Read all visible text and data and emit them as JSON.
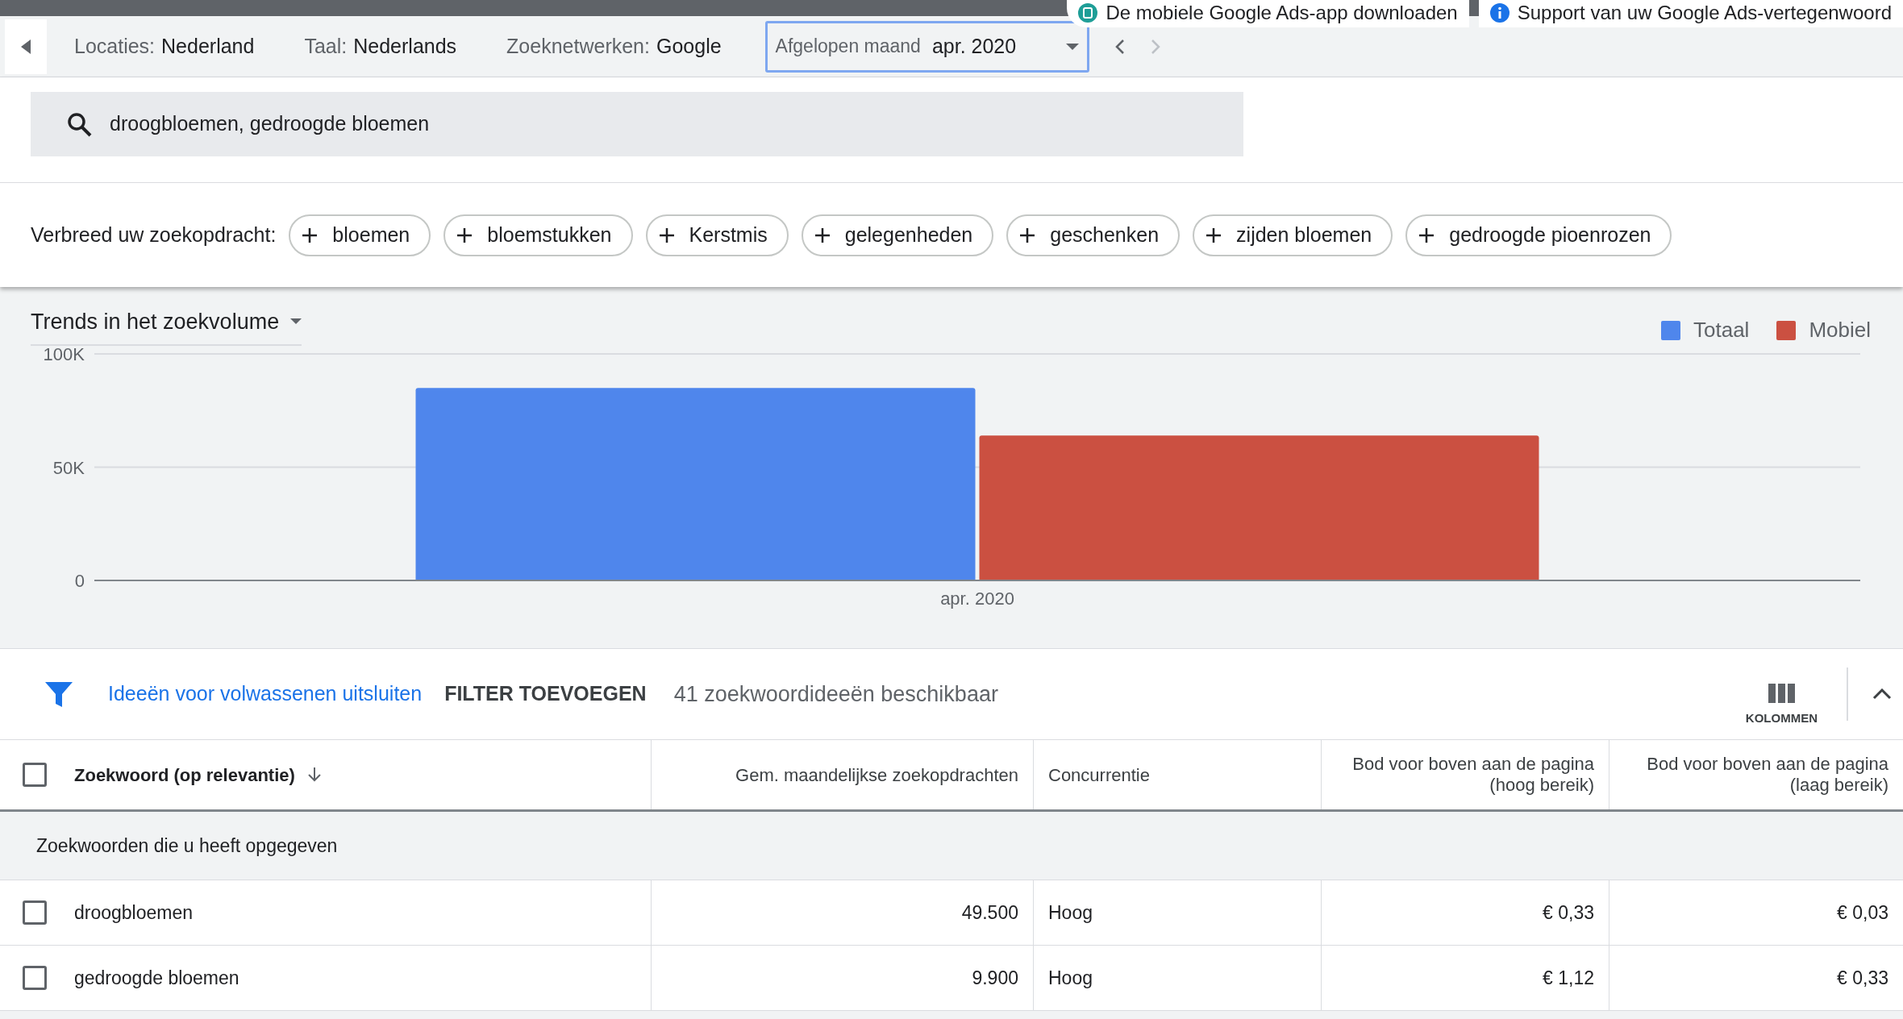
{
  "notifications": [
    {
      "kind": "app",
      "text": "De mobiele Google Ads-app downloaden"
    },
    {
      "kind": "info",
      "text": "Support van uw Google Ads-vertegenwoord"
    }
  ],
  "top_bar": {
    "filters": [
      {
        "label": "Locaties:",
        "value": "Nederland"
      },
      {
        "label": "Taal:",
        "value": "Nederlands"
      },
      {
        "label": "Zoeknetwerken:",
        "value": "Google"
      }
    ],
    "date_range": {
      "label": "Afgelopen maand",
      "value": "apr. 2020"
    }
  },
  "search": {
    "value": "droogbloemen, gedroogde bloemen"
  },
  "refine": {
    "label": "Verbreed uw zoekopdracht:",
    "chips": [
      "bloemen",
      "bloemstukken",
      "Kerstmis",
      "gelegenheden",
      "geschenken",
      "zijden bloemen",
      "gedroogde pioenrozen"
    ]
  },
  "trends": {
    "title": "Trends in het zoekvolume",
    "chart_data": {
      "type": "bar",
      "categories": [
        "apr. 2020"
      ],
      "series": [
        {
          "name": "Totaal",
          "color": "#4f86ec",
          "values": [
            85000
          ]
        },
        {
          "name": "Mobiel",
          "color": "#cb5041",
          "values": [
            64000
          ]
        }
      ],
      "ylim": [
        0,
        100000
      ],
      "yticks": [
        {
          "value": 0,
          "label": "0"
        },
        {
          "value": 50000,
          "label": "50K"
        },
        {
          "value": 100000,
          "label": "100K"
        }
      ]
    }
  },
  "filter_bar": {
    "exclude_link": "Ideeën voor volwassenen uitsluiten",
    "add_filter": "FILTER TOEVOEGEN",
    "count": "41 zoekwoordideeën beschikbaar",
    "columns_button": "KOLOMMEN"
  },
  "table": {
    "select_all_checked": false,
    "columns": [
      "Zoekwoord (op relevantie)",
      "Gem. maandelijkse zoekopdrachten",
      "Concurrentie",
      "Bod voor boven aan de pagina (hoog bereik)",
      "Bod voor boven aan de pagina (laag bereik)"
    ],
    "sections": [
      {
        "title": "Zoekwoorden die u heeft opgegeven",
        "rows": [
          {
            "checked": false,
            "cells": [
              "droogbloemen",
              "49.500",
              "Hoog",
              "€ 0,33",
              "€ 0,03"
            ]
          },
          {
            "checked": false,
            "cells": [
              "gedroogde bloemen",
              "9.900",
              "Hoog",
              "€ 1,12",
              "€ 0,33"
            ]
          }
        ]
      }
    ]
  }
}
